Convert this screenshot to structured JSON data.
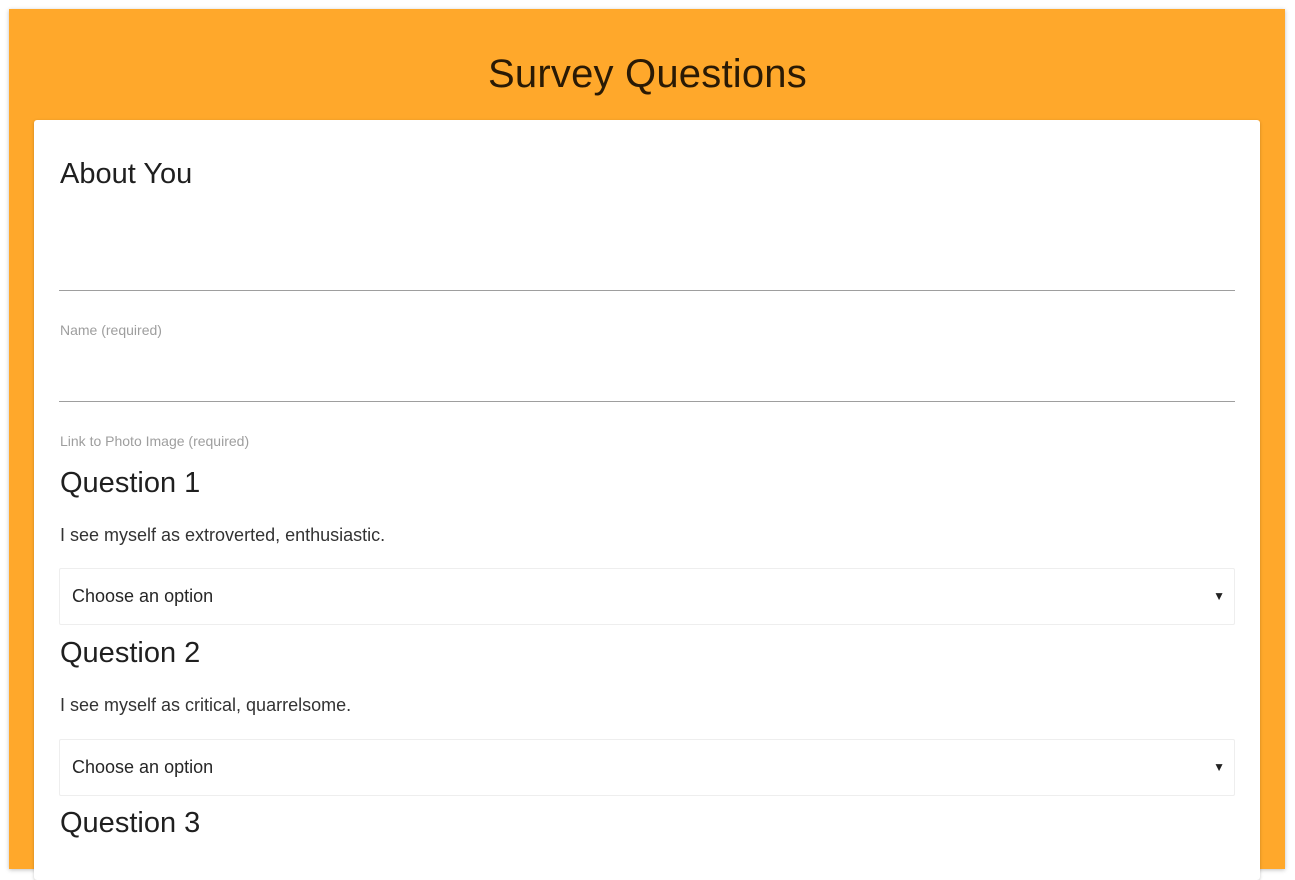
{
  "page": {
    "title": "Survey Questions",
    "background_color": "#ffa82b"
  },
  "about": {
    "heading": "About You",
    "name_label": "Name (required)",
    "name_value": "",
    "photo_label": "Link to Photo Image (required)",
    "photo_value": ""
  },
  "questions": [
    {
      "heading": "Question 1",
      "text": "I see myself as extroverted, enthusiastic.",
      "selected": "Choose an option"
    },
    {
      "heading": "Question 2",
      "text": "I see myself as critical, quarrelsome.",
      "selected": "Choose an option"
    },
    {
      "heading": "Question 3"
    }
  ],
  "icons": {
    "select_caret": "caret-down-icon"
  }
}
